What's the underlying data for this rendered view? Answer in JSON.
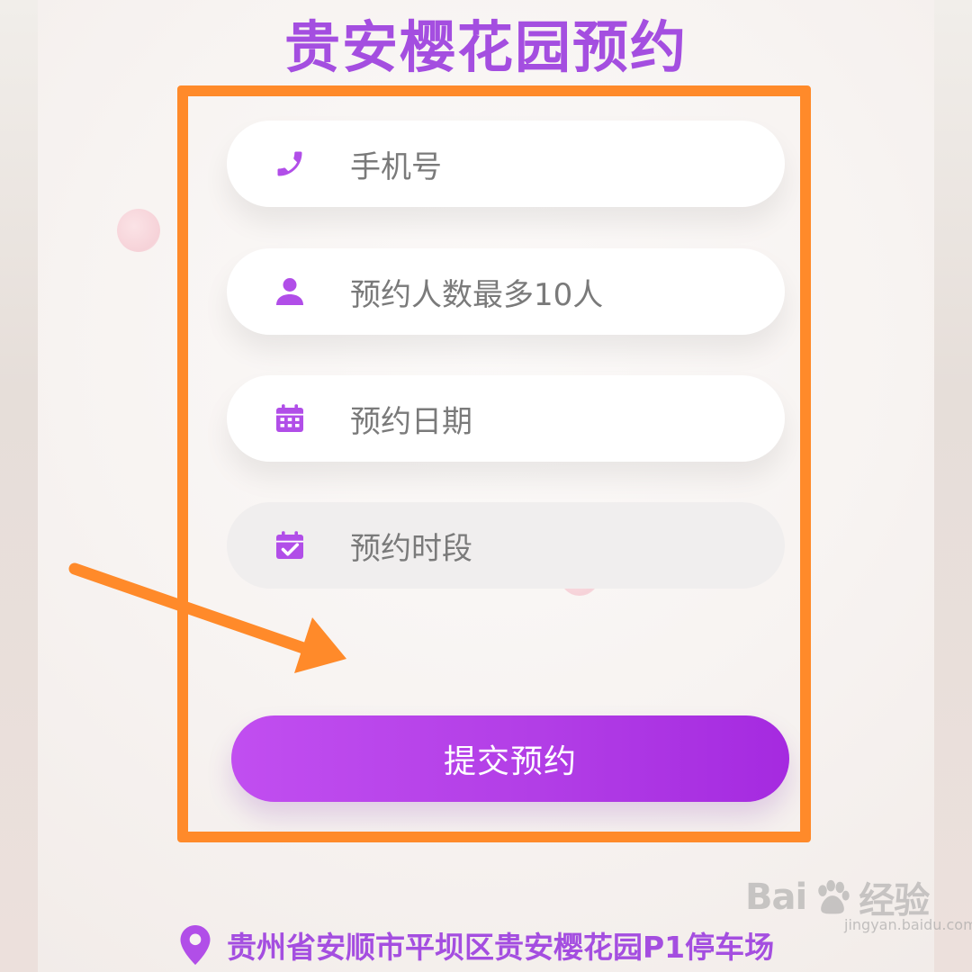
{
  "header": {
    "title": "贵安樱花园预约"
  },
  "form": {
    "phone_placeholder": "手机号",
    "people_placeholder": "预约人数最多10人",
    "date_placeholder": "预约日期",
    "timeslot_placeholder": "预约时段",
    "submit_label": "提交预约"
  },
  "footer": {
    "address": "贵州省安顺市平坝区贵安樱花园P1停车场"
  },
  "watermark": {
    "brand_left": "Bai",
    "brand_right": "经验",
    "url": "jingyan.baidu.com"
  },
  "colors": {
    "accent": "#a44ee0",
    "annotation": "#ff8a2a"
  },
  "icons": {
    "phone": "phone-icon",
    "people": "user-icon",
    "date": "calendar-icon",
    "timeslot": "calendar-check-icon",
    "location": "location-pin-icon"
  }
}
